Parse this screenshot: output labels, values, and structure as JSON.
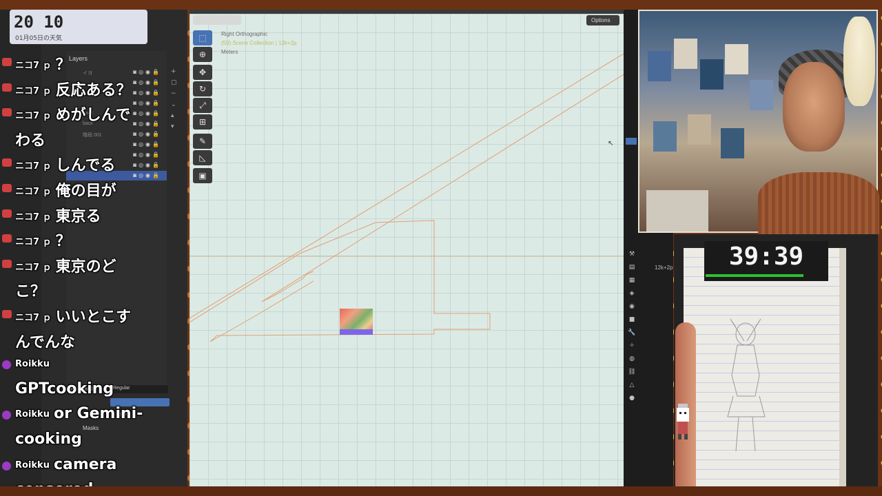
{
  "clock": {
    "time": "20 10",
    "date": "01月05日の天気"
  },
  "layers_panel": {
    "header": "Layers",
    "rows": [
      {
        "name": "イヨ",
        "active": false
      },
      {
        "name": "",
        "active": false
      },
      {
        "name": "",
        "active": false
      },
      {
        "name": "",
        "active": false
      },
      {
        "name": "back",
        "active": false
      },
      {
        "name": "back",
        "active": false
      },
      {
        "name": "階段.001",
        "active": false
      },
      {
        "name": "",
        "active": false
      },
      {
        "name": "",
        "active": false
      },
      {
        "name": "",
        "active": false
      },
      {
        "name": "",
        "active": true
      }
    ],
    "blend_mode_label": "Blend Mode",
    "blend_mode_value": "Regular",
    "lights_label": "Lights",
    "masks_label": "Masks"
  },
  "viewport": {
    "view_name": "Right Orthographic",
    "collection": "(59) Scene Collection | 12k+2p",
    "units": "Meters",
    "options_label": "Options"
  },
  "properties_panel": {
    "object_label": "12k+2p"
  },
  "chat": [
    {
      "user": "ニコ7 ｐ",
      "text": "？",
      "badge": "red"
    },
    {
      "user": "ニコ7 ｐ",
      "text": "反応ある？",
      "badge": "red"
    },
    {
      "user": "ニコ7 ｐ",
      "text": "めがしんで",
      "badge": "red"
    },
    {
      "user": "",
      "text": "わる",
      "badge": ""
    },
    {
      "user": "ニコ7 ｐ",
      "text": "しんでる",
      "badge": "red"
    },
    {
      "user": "ニコ7 ｐ",
      "text": "俺の目が",
      "badge": "red"
    },
    {
      "user": "ニコ7 ｐ",
      "text": "東京る",
      "badge": "red"
    },
    {
      "user": "ニコ7 ｐ",
      "text": "？",
      "badge": "red"
    },
    {
      "user": "ニコ7 ｐ",
      "text": "東京のど",
      "badge": "red"
    },
    {
      "user": "",
      "text": "こ？",
      "badge": ""
    },
    {
      "user": "ニコ7 ｐ",
      "text": "いいとこす",
      "badge": "red"
    },
    {
      "user": "",
      "text": "んでんな",
      "badge": ""
    },
    {
      "user": "Roikku",
      "text": "",
      "badge": "purple"
    },
    {
      "user": "",
      "text": "GPTcooking",
      "badge": ""
    },
    {
      "user": "Roikku",
      "text": "or Gemini-",
      "badge": "purple"
    },
    {
      "user": "",
      "text": "cooking",
      "badge": ""
    },
    {
      "user": "Roikku",
      "text": "camera",
      "badge": "purple"
    },
    {
      "user": "",
      "text": "censored",
      "badge": ""
    }
  ],
  "timer": {
    "text": "39:39",
    "progress": 0.79,
    "color": "#2ec02e"
  },
  "colors": {
    "viewport_bg": "#dceae6",
    "outline": "#e0a070",
    "active_layer": "#3d5a9e",
    "blender_accent": "#4772b3"
  }
}
